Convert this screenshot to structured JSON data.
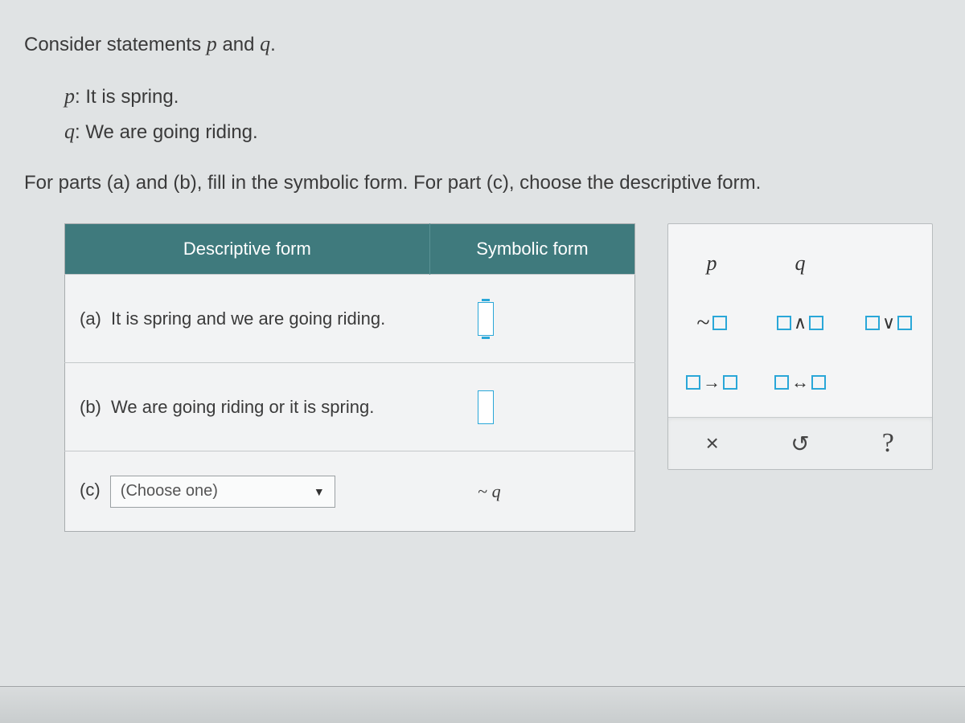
{
  "intro": {
    "prefix": "Consider statements ",
    "var1": "p",
    "mid": " and ",
    "var2": "q",
    "suffix": "."
  },
  "definitions": {
    "p_var": "p",
    "p_text": ": It is spring.",
    "q_var": "q",
    "q_text": ": We are going riding."
  },
  "instructions": "For parts (a) and (b), fill in the symbolic form. For part (c), choose the descriptive form.",
  "table": {
    "header_descriptive": "Descriptive form",
    "header_symbolic": "Symbolic form",
    "rows": {
      "a": {
        "label": "(a)",
        "text": "It is spring and we are going riding."
      },
      "b": {
        "label": "(b)",
        "text": "We are going riding or it is spring."
      },
      "c": {
        "label": "(c)",
        "dropdown_placeholder": "(Choose one)",
        "symbolic_prefix": "~ ",
        "symbolic_var": "q"
      }
    }
  },
  "palette": {
    "var_p": "p",
    "var_q": "q",
    "not_sym": "~",
    "and_sym": "∧",
    "or_sym": "∨",
    "cond_sym": "→",
    "bicond_sym": "↔"
  },
  "actions": {
    "clear": "×",
    "undo": "↺",
    "help": "?"
  }
}
